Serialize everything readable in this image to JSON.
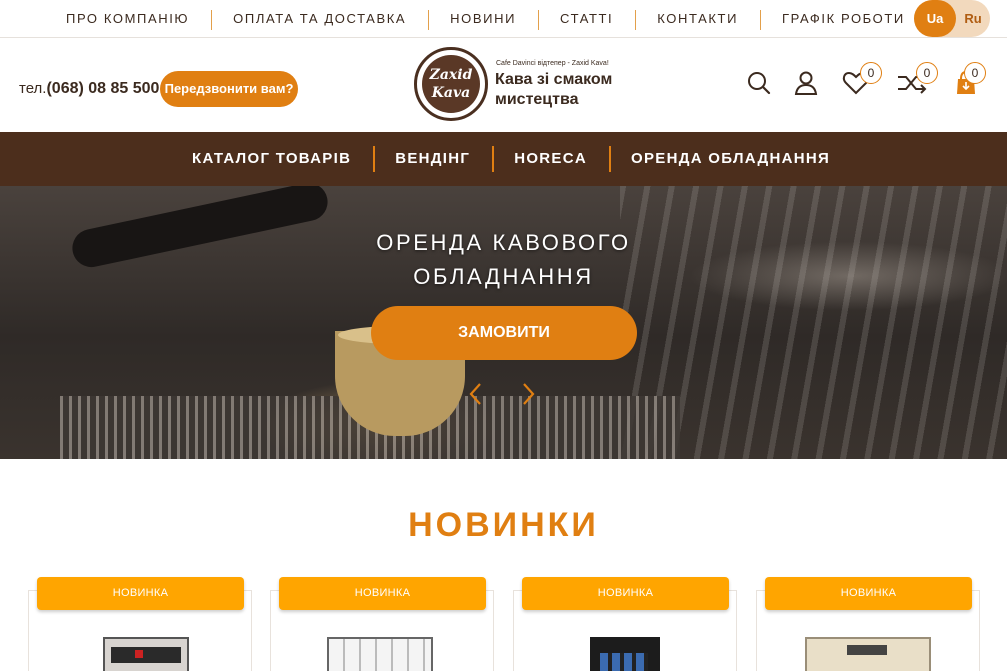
{
  "topnav": {
    "items": [
      "ПРО КОМПАНІЮ",
      "ОПЛАТА ТА ДОСТАВКА",
      "НОВИНИ",
      "СТАТТІ",
      "КОНТАКТИ",
      "ГРАФІК РОБОТИ"
    ]
  },
  "lang": {
    "ua": "Ua",
    "ru": "Ru",
    "active": "Ua"
  },
  "header": {
    "phone_prefix": "тел.",
    "phone_number": "(068) 08 85 500",
    "callback_label": "Передзвонити вам?",
    "logo_line1": "Zaxid",
    "logo_line2": "Kava",
    "slogan_small": "Cafe Davinci відтепер - Zaxid Kava!",
    "slogan": "Кава зі смаком мистецтва",
    "wishlist_count": "0",
    "compare_count": "0",
    "cart_count": "0"
  },
  "mainnav": {
    "items": [
      "КАТАЛОГ ТОВАРІВ",
      "ВЕНДІНГ",
      "HORECA",
      "ОРЕНДА ОБЛАДНАННЯ"
    ]
  },
  "hero": {
    "title_line1": "ОРЕНДА КАВОВОГО",
    "title_line2": "ОБЛАДНАННЯ",
    "button_label": "ЗАМОВИТИ"
  },
  "new_section": {
    "title": "НОВИНКИ",
    "cards": [
      {
        "tag": "НОВИНКА"
      },
      {
        "tag": "НОВИНКА"
      },
      {
        "tag": "НОВИНКА"
      },
      {
        "tag": "НОВИНКА"
      }
    ]
  },
  "colors": {
    "accent": "#e07f12",
    "brown_nav": "#4c2e1c",
    "tag_orange": "#ffa500",
    "text_dark": "#3b2a1f"
  }
}
